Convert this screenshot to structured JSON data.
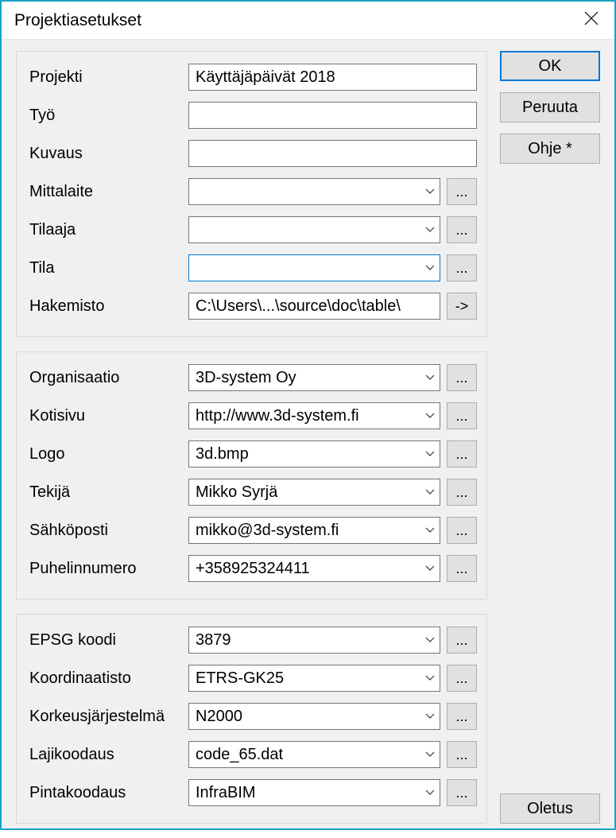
{
  "title": "Projektiasetukset",
  "buttons": {
    "ok": "OK",
    "cancel": "Peruuta",
    "help": "Ohje *",
    "default": "Oletus",
    "ellipsis": "...",
    "arrow": "->"
  },
  "group1": {
    "projekti": {
      "label": "Projekti",
      "value": "Käyttäjäpäivät 2018"
    },
    "tyo": {
      "label": "Työ",
      "value": ""
    },
    "kuvaus": {
      "label": "Kuvaus",
      "value": ""
    },
    "mittalaite": {
      "label": "Mittalaite",
      "value": ""
    },
    "tilaaja": {
      "label": "Tilaaja",
      "value": ""
    },
    "tila": {
      "label": "Tila",
      "value": ""
    },
    "hakemisto": {
      "label": "Hakemisto",
      "value": "C:\\Users\\...\\source\\doc\\table\\"
    }
  },
  "group2": {
    "organisaatio": {
      "label": "Organisaatio",
      "value": "3D-system Oy"
    },
    "kotisivu": {
      "label": "Kotisivu",
      "value": "http://www.3d-system.fi"
    },
    "logo": {
      "label": "Logo",
      "value": "3d.bmp"
    },
    "tekija": {
      "label": "Tekijä",
      "value": "Mikko Syrjä"
    },
    "sahkoposti": {
      "label": "Sähköposti",
      "value": "mikko@3d-system.fi"
    },
    "puhelinnumero": {
      "label": "Puhelinnumero",
      "value": "+358925324411"
    }
  },
  "group3": {
    "epsg": {
      "label": "EPSG koodi",
      "value": "3879"
    },
    "koordinaatisto": {
      "label": "Koordinaatisto",
      "value": "ETRS-GK25"
    },
    "korkeus": {
      "label": "Korkeusjärjestelmä",
      "value": "N2000"
    },
    "lajikoodaus": {
      "label": "Lajikoodaus",
      "value": "code_65.dat"
    },
    "pintakoodaus": {
      "label": "Pintakoodaus",
      "value": "InfraBIM"
    }
  }
}
